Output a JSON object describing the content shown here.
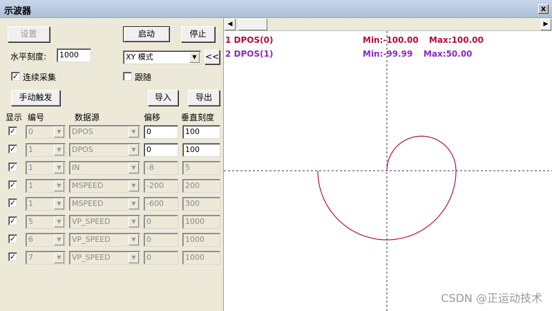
{
  "window": {
    "title": "示波器",
    "close_glyph": "x"
  },
  "controls": {
    "settings": "设置",
    "start": "启动",
    "stop": "停止",
    "h_scale_label": "水平刻度:",
    "h_scale_value": "1000",
    "mode_value": "XY 模式",
    "collapse": "<<",
    "continuous_label": "连续采集",
    "continuous_checked": true,
    "follow_label": "跟随",
    "follow_checked": false,
    "manual_trigger": "手动触发",
    "import": "导入",
    "export": "导出"
  },
  "table": {
    "headers": {
      "show": "显示",
      "num": "编号",
      "source": "数据源",
      "offset": "偏移",
      "vscale": "垂直刻度"
    },
    "rows": [
      {
        "checked": true,
        "num": "0",
        "source": "DPOS",
        "offset": "0",
        "vscale": "100",
        "enabled": true
      },
      {
        "checked": true,
        "num": "1",
        "source": "DPOS",
        "offset": "0",
        "vscale": "100",
        "enabled": true
      },
      {
        "checked": true,
        "num": "1",
        "source": "IN",
        "offset": "-8",
        "vscale": "5",
        "enabled": false
      },
      {
        "checked": true,
        "num": "1",
        "source": "MSPEED",
        "offset": "-200",
        "vscale": "200",
        "enabled": false
      },
      {
        "checked": true,
        "num": "1",
        "source": "MSPEED",
        "offset": "-600",
        "vscale": "300",
        "enabled": false
      },
      {
        "checked": true,
        "num": "5",
        "source": "VP_SPEED",
        "offset": "0",
        "vscale": "1000",
        "enabled": false
      },
      {
        "checked": true,
        "num": "6",
        "source": "VP_SPEED",
        "offset": "0",
        "vscale": "1000",
        "enabled": false
      },
      {
        "checked": true,
        "num": "7",
        "source": "VP_SPEED",
        "offset": "0",
        "vscale": "1000",
        "enabled": false
      }
    ]
  },
  "scope": {
    "legend": [
      {
        "name": "1 DPOS(0)",
        "min": "Min:-100.00",
        "max": "Max:100.00",
        "color": "#b0103a"
      },
      {
        "name": "2 DPOS(1)",
        "min": "Min:-99.99",
        "max": "Max:50.00",
        "color": "#8a2bbf"
      }
    ],
    "trace_color": "#b0103a",
    "watermark": "CSDN @正运动技术"
  }
}
